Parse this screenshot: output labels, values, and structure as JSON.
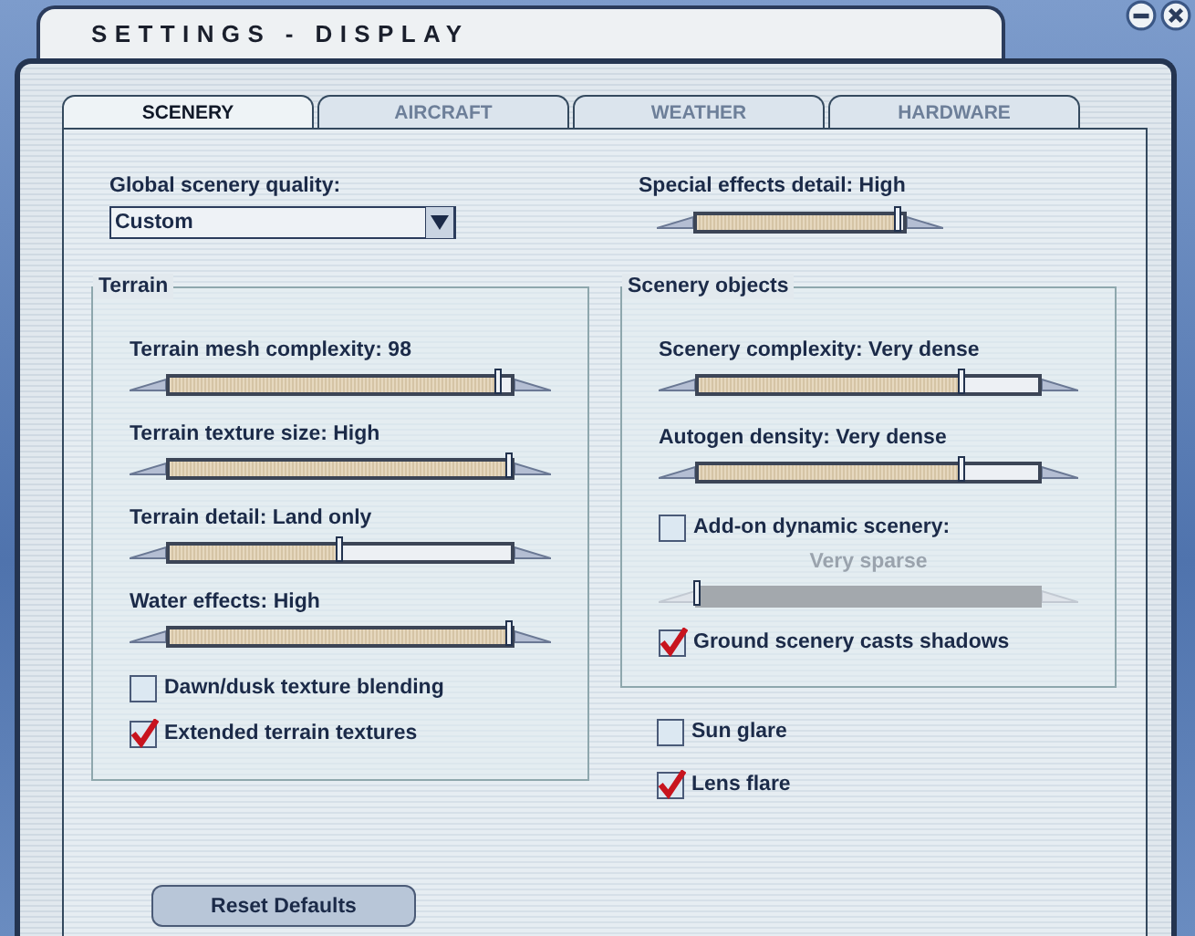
{
  "window": {
    "title": "SETTINGS - DISPLAY"
  },
  "tabs": [
    {
      "label": "SCENERY",
      "selected": true
    },
    {
      "label": "AIRCRAFT",
      "selected": false
    },
    {
      "label": "WEATHER",
      "selected": false
    },
    {
      "label": "HARDWARE",
      "selected": false
    }
  ],
  "global_quality": {
    "label": "Global scenery quality:",
    "value": "Custom"
  },
  "special_effects": {
    "label": "Special effects detail: High",
    "level": 0.98,
    "disabled": false
  },
  "terrain": {
    "title": "Terrain",
    "items": [
      {
        "kind": "slider",
        "label": "Terrain mesh complexity: 98",
        "level": 0.97,
        "disabled": false
      },
      {
        "kind": "slider",
        "label": "Terrain texture size: High",
        "level": 1,
        "disabled": false
      },
      {
        "kind": "slider",
        "label": "Terrain detail: Land only",
        "level": 0.5,
        "disabled": false
      },
      {
        "kind": "slider",
        "label": "Water effects: High",
        "level": 1,
        "disabled": false
      },
      {
        "kind": "checkbox",
        "label": "Dawn/dusk texture blending",
        "checked": false
      },
      {
        "kind": "checkbox",
        "label": "Extended terrain textures",
        "checked": true
      }
    ]
  },
  "scenery_objects": {
    "title": "Scenery objects",
    "items": [
      {
        "kind": "slider",
        "label": "Scenery complexity: Very dense",
        "level": 0.78,
        "disabled": false
      },
      {
        "kind": "slider",
        "label": "Autogen density: Very dense",
        "level": 0.78,
        "disabled": false
      },
      {
        "kind": "checkbox",
        "label": "Add-on dynamic scenery:",
        "checked": false
      },
      {
        "kind": "slider",
        "label": "Very sparse",
        "level": 0,
        "disabled": true
      },
      {
        "kind": "checkbox",
        "label": "Ground scenery casts shadows",
        "checked": true
      }
    ]
  },
  "effects": [
    {
      "kind": "checkbox",
      "label": "Sun glare",
      "checked": false
    },
    {
      "kind": "checkbox",
      "label": "Lens flare",
      "checked": true
    }
  ],
  "buttons": [
    {
      "label": "Reset Defaults"
    }
  ]
}
